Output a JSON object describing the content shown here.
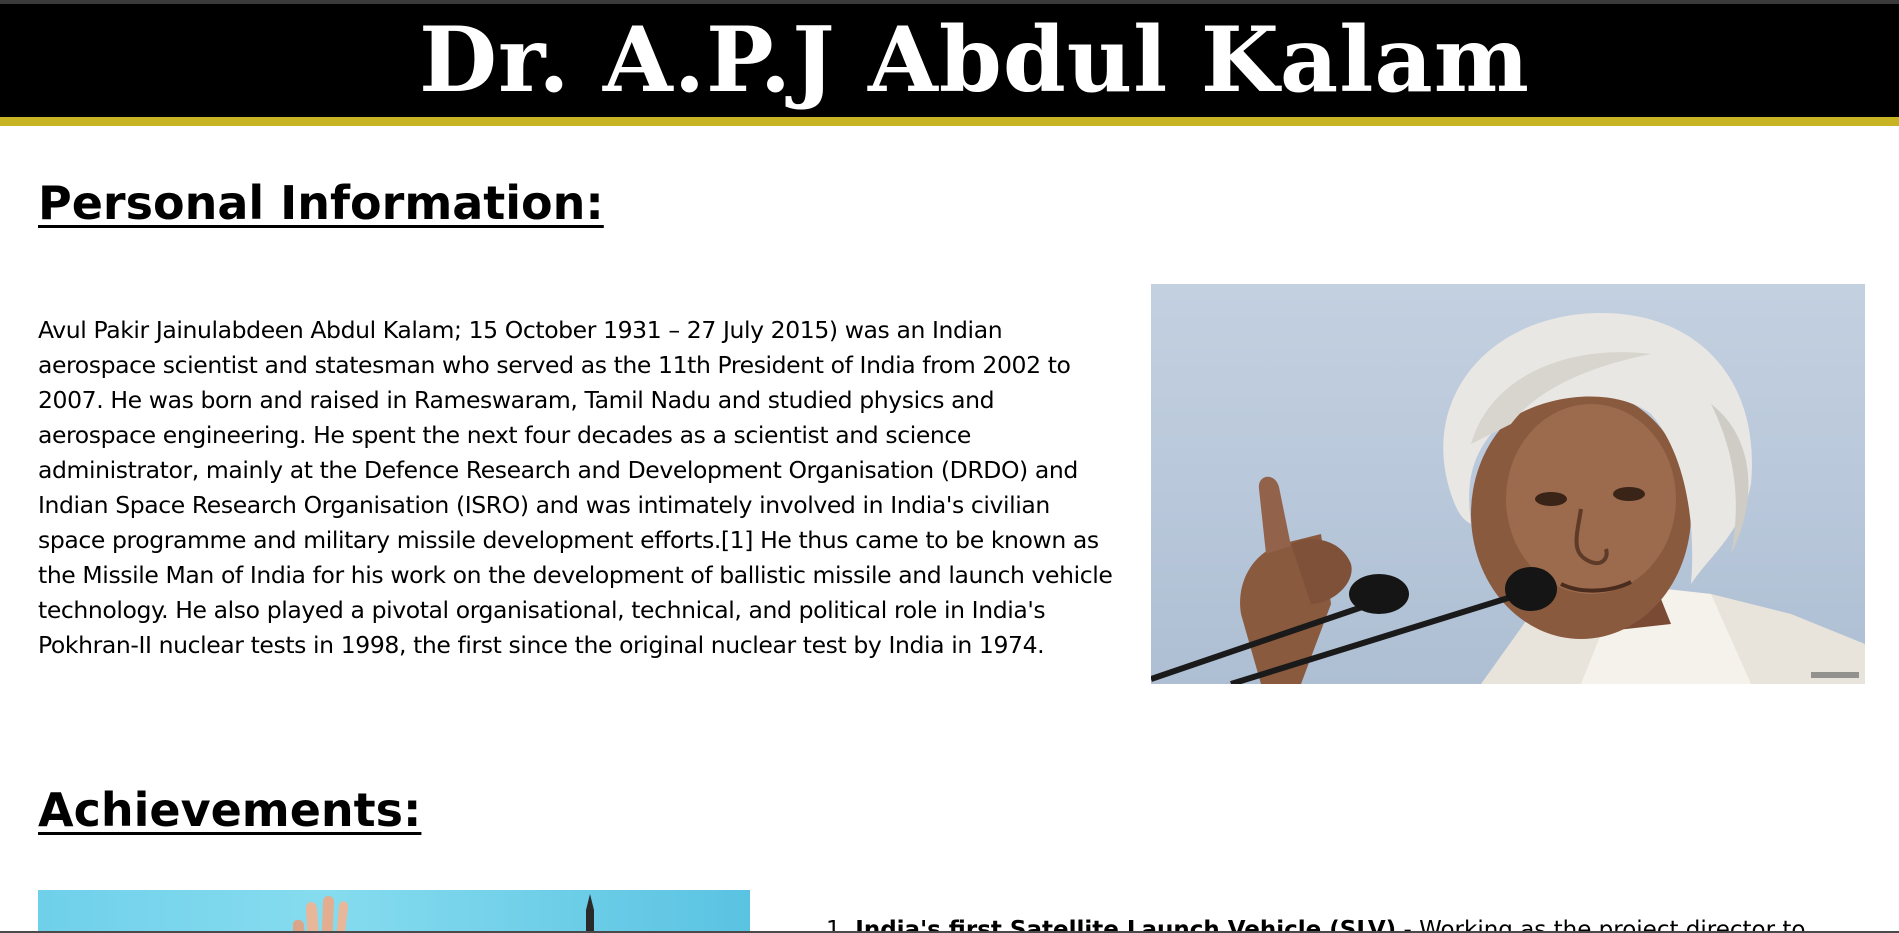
{
  "header": {
    "title": "Dr. A.P.J Abdul Kalam"
  },
  "personal": {
    "heading": "Personal Information:",
    "bio": "Avul Pakir Jainulabdeen Abdul Kalam; 15 October 1931 – 27 July 2015) was an Indian aerospace scientist and statesman who served as the 11th President of India from 2002 to 2007. He was born and raised in Rameswaram, Tamil Nadu and studied physics and aerospace engineering. He spent the next four decades as a scientist and science administrator, mainly at the Defence Research and Development Organisation (DRDO) and Indian Space Research Organisation (ISRO) and was intimately involved in India's civilian space programme and military missile development efforts.[1] He thus came to be known as the Missile Man of India for his work on the development of ballistic missile and launch vehicle technology. He also played a pivotal organisational, technical, and political role in India's Pokhran-II nuclear tests in 1998, the first since the original nuclear test by India in 1974."
  },
  "achievements": {
    "heading": "Achievements:",
    "items": [
      {
        "number": "1.",
        "title": "India's first Satellite Launch Vehicle (SLV)",
        "text": "- Working as the project director to"
      }
    ]
  },
  "colors": {
    "header_bg": "#000000",
    "header_border": "#c8b323",
    "header_text": "#ffffff",
    "page_bg": "#ffffff"
  },
  "icons": {
    "portrait": "portrait-photo",
    "achievement_image": "missile-launch-photo"
  }
}
